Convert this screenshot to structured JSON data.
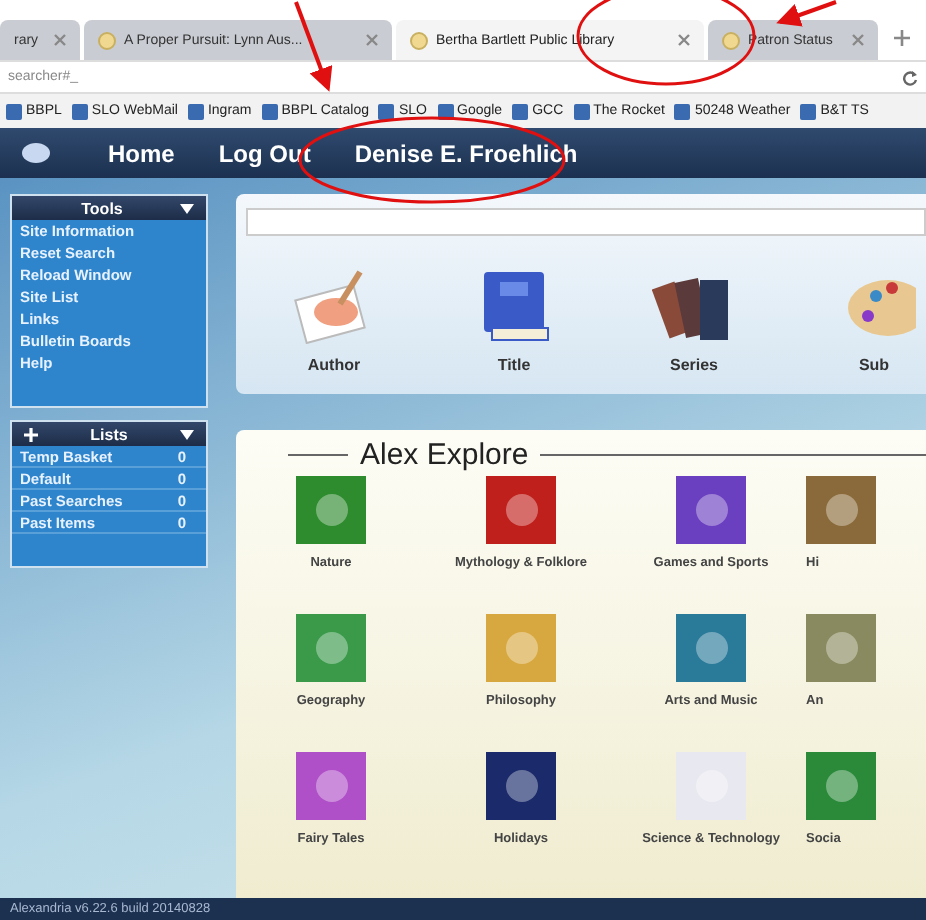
{
  "browser": {
    "tabs": [
      {
        "label": "rary",
        "selected": false
      },
      {
        "label": "A Proper Pursuit: Lynn Aus...",
        "selected": false
      },
      {
        "label": "Bertha Bartlett Public Library",
        "selected": true
      },
      {
        "label": "Patron Status",
        "selected": false
      }
    ],
    "address": "searcher#_",
    "bookmarks": [
      "BBPL",
      "SLO WebMail",
      "Ingram",
      "BBPL Catalog",
      "SLO",
      "Google",
      "GCC",
      "The Rocket",
      "50248 Weather",
      "B&T TS"
    ]
  },
  "nav": [
    "Home",
    "Log Out",
    "Denise E. Froehlich"
  ],
  "sidebar": {
    "tools": {
      "title": "Tools",
      "items": [
        "Site Information",
        "Reset Search",
        "Reload Window",
        "Site List",
        "Links",
        "Bulletin Boards",
        "Help"
      ]
    },
    "lists": {
      "title": "Lists",
      "items": [
        {
          "label": "Temp Basket",
          "count": "0"
        },
        {
          "label": "Default",
          "count": "0"
        },
        {
          "label": "Past Searches",
          "count": "0"
        },
        {
          "label": "Past Items",
          "count": "0"
        }
      ]
    }
  },
  "search_types": [
    {
      "kind": "author",
      "label": "Author"
    },
    {
      "kind": "title",
      "label": "Title"
    },
    {
      "kind": "series",
      "label": "Series"
    },
    {
      "kind": "subject",
      "label": "Sub"
    }
  ],
  "explore": {
    "title": "Alex Explore",
    "items": [
      {
        "label": "Nature",
        "color": "#2e8b2e"
      },
      {
        "label": "Mythology & Folklore",
        "color": "#c0201c"
      },
      {
        "label": "Games and Sports",
        "color": "#6a3fc0"
      },
      {
        "label": "Hi",
        "color": "#8a6a3a"
      },
      {
        "label": "Geography",
        "color": "#3a9a4a"
      },
      {
        "label": "Philosophy",
        "color": "#d8a840"
      },
      {
        "label": "Arts and Music",
        "color": "#2a7a9a"
      },
      {
        "label": "An",
        "color": "#8a8a60"
      },
      {
        "label": "Fairy Tales",
        "color": "#b050c8"
      },
      {
        "label": "Holidays",
        "color": "#1a2a6a"
      },
      {
        "label": "Science & Technology",
        "color": "#e8e8f0"
      },
      {
        "label": "Socia",
        "color": "#2a8a3a"
      }
    ]
  },
  "status_bar": "Alexandria v6.22.6 build 20140828"
}
